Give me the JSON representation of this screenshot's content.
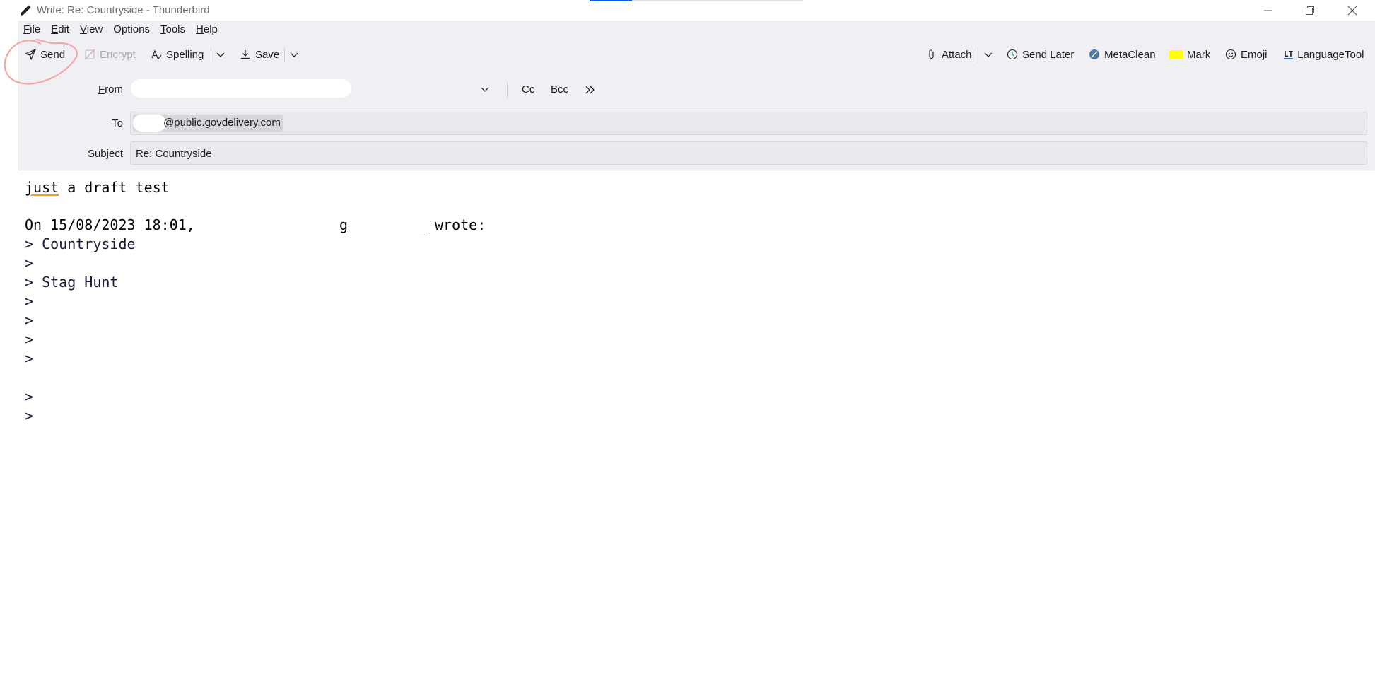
{
  "window": {
    "title": "Write: Re: Countryside - Thunderbird",
    "controls": [
      "minimize",
      "maximize",
      "close"
    ]
  },
  "menubar": {
    "items": [
      {
        "label": "File",
        "underline": "F"
      },
      {
        "label": "Edit",
        "underline": "E"
      },
      {
        "label": "View",
        "underline": "V"
      },
      {
        "label": "Options",
        "underline": ""
      },
      {
        "label": "Tools",
        "underline": "T"
      },
      {
        "label": "Help",
        "underline": "H"
      }
    ]
  },
  "toolbar": {
    "send": "Send",
    "encrypt": "Encrypt",
    "spelling": "Spelling",
    "save": "Save",
    "attach": "Attach",
    "send_later": "Send Later",
    "metaclean": "MetaClean",
    "mark": "Mark",
    "emoji": "Emoji",
    "languagetool": "LanguageTool"
  },
  "header": {
    "from_label": "From",
    "to_label": "To",
    "subject_label": "Subject",
    "cc": "Cc",
    "bcc": "Bcc",
    "to_address": "public.govdelivery.com",
    "to_address_prefix": "@",
    "subject_value": "Re: Countryside"
  },
  "body": {
    "line1_word1": "just",
    "line1_rest": " a draft test",
    "attribution_start": "On 15/08/2023 18:01,",
    "attribution_end": "wrote:",
    "quoted": [
      "> Countryside",
      ">",
      "> Stag Hunt",
      ">",
      ">",
      ">",
      ">"
    ],
    "quoted_tail": [
      ">",
      ">"
    ]
  },
  "colors": {
    "accent": "#0060df",
    "panel": "#f0f0f4",
    "mark_highlight": "#ffff00",
    "annotation": "#f4a6a6"
  }
}
